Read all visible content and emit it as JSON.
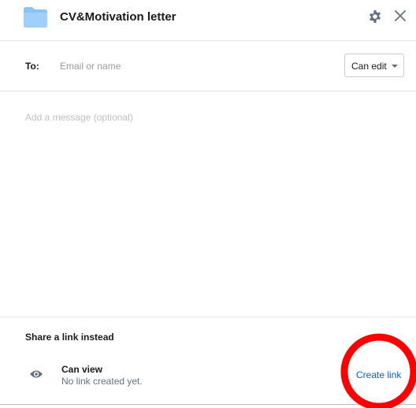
{
  "header": {
    "folder_icon": "folder-icon",
    "title": "CV&Motivation letter",
    "settings_icon": "gear-icon",
    "close_icon": "close-icon"
  },
  "recipient": {
    "label": "To:",
    "placeholder": "Email or name",
    "value": "",
    "permission": {
      "selected": "Can edit",
      "icon": "chevron-down-icon"
    }
  },
  "message": {
    "placeholder": "Add a message (optional)",
    "value": ""
  },
  "share_link": {
    "title": "Share a link instead",
    "icon": "eye-icon",
    "permission": "Can view",
    "status": "No link created yet.",
    "action_label": "Create link"
  },
  "annotation": {
    "shape": "circle",
    "color": "#ff0000",
    "target": "create-link-button"
  },
  "colors": {
    "accent": "#0061fe",
    "folder": "#8cc3f5",
    "highlight": "#ff0000"
  }
}
